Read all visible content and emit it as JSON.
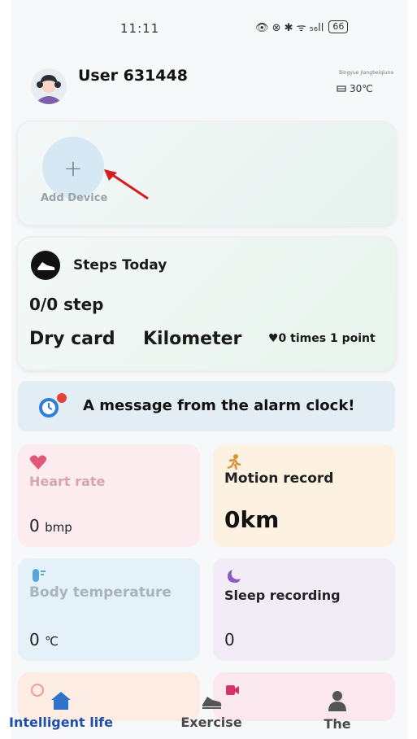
{
  "status_bar": {
    "time": "11:11",
    "icons": "👁 ⊗ ✱ ᯤ ₅₆ll",
    "battery": "66"
  },
  "header": {
    "username": "User 631448",
    "location": "Bingyue Jiangbeiqiuna",
    "weather": "30℃"
  },
  "device_card": {
    "add_symbol": "+",
    "add_label": "Add Device"
  },
  "steps_card": {
    "title": "Steps Today",
    "count": "0/0 step",
    "dry_card": "Dry card",
    "kilometer": "Kilometer",
    "times": "♥0 times 1 point"
  },
  "alarm": {
    "message": "A message from the alarm clock!"
  },
  "tiles": {
    "heart": {
      "label": "Heart rate",
      "value": "0",
      "unit": "bmp"
    },
    "motion": {
      "label": "Motion record",
      "value": "0km"
    },
    "temperature": {
      "label": "Body temperature",
      "value": "0",
      "unit": "℃"
    },
    "sleep": {
      "label": "Sleep recording",
      "value": "0"
    }
  },
  "bottom_nav": {
    "items": [
      {
        "label": "Intelligent life",
        "icon": "home-icon",
        "active": true
      },
      {
        "label": "Exercise",
        "icon": "shoe-icon",
        "active": false
      },
      {
        "label": "The",
        "icon": "person-icon",
        "active": false
      }
    ]
  },
  "colors": {
    "active_nav": "#1f4fa8",
    "heart_tile": "#fcecef",
    "motion_tile": "#fdf1e1",
    "temp_tile": "#e4f1f9",
    "sleep_tile": "#f2ecf6",
    "alarm_bg": "#e3eef4"
  }
}
